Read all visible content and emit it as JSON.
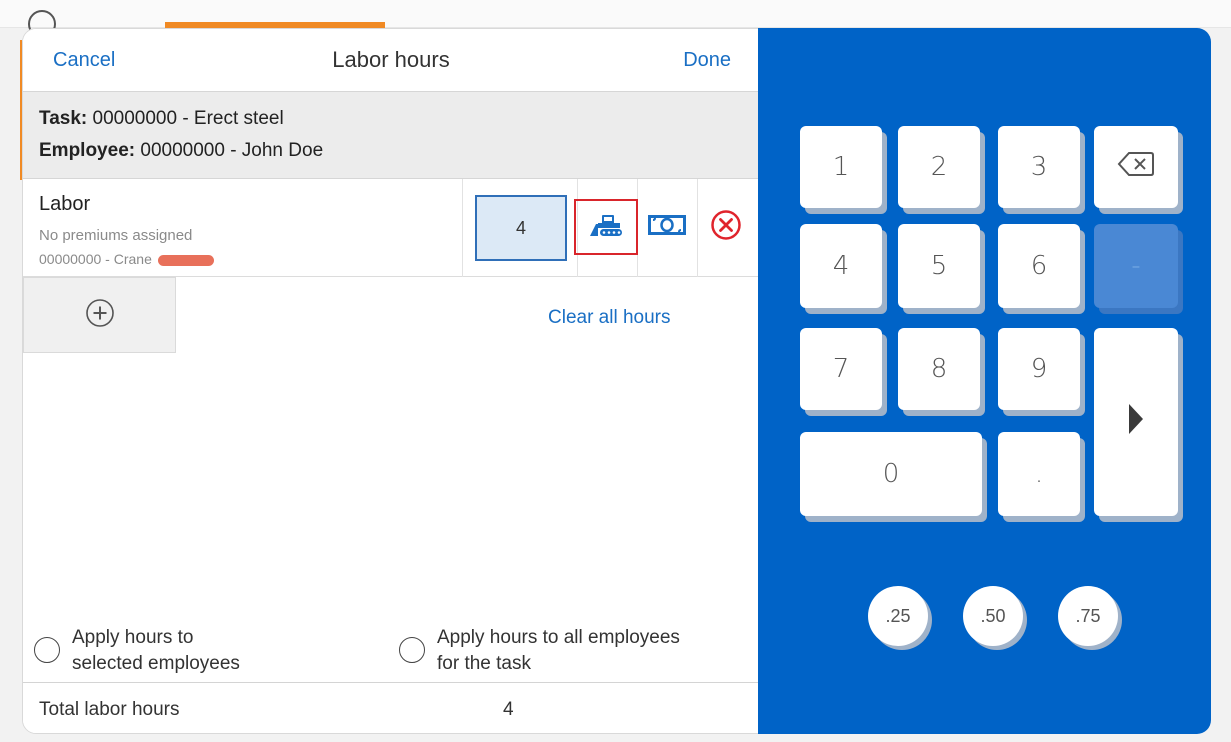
{
  "header": {
    "cancel_label": "Cancel",
    "title": "Labor hours",
    "done_label": "Done"
  },
  "info": {
    "task_label": "Task:",
    "task_value": "00000000 - Erect steel",
    "employee_label": "Employee:",
    "employee_value": "00000000 - John Doe"
  },
  "labor": {
    "title": "Labor",
    "premiums": "No premiums assigned",
    "equipment": "00000000 - Crane",
    "hours": "4",
    "equipment_icon": "bulldozer-icon",
    "premium_icon": "money-icon",
    "remove_icon": "remove-circle-icon"
  },
  "actions": {
    "add_icon": "plus-circle-icon",
    "clear_all": "Clear all hours"
  },
  "apply_options": [
    {
      "line1": "Apply hours to",
      "line2": "selected employees",
      "selected": false
    },
    {
      "line1": "Apply hours to all employees",
      "line2": "for the task",
      "selected": false
    }
  ],
  "total": {
    "label": "Total labor hours",
    "value": "4"
  },
  "keypad": {
    "keys": {
      "k1": "1",
      "k2": "2",
      "k3": "3",
      "k4": "4",
      "k5": "5",
      "k6": "6",
      "k7": "7",
      "k8": "8",
      "k9": "9",
      "k0": "0",
      "dot": ".",
      "minus": "-"
    },
    "backspace_icon": "backspace-icon",
    "next_icon": "play-arrow-icon",
    "fractions": [
      ".25",
      ".50",
      ".75"
    ]
  },
  "colors": {
    "accent": "#1a6fc4",
    "keypad_bg": "#0063c7",
    "highlight": "#d9252b",
    "equipment_pill": "#e8705a"
  }
}
